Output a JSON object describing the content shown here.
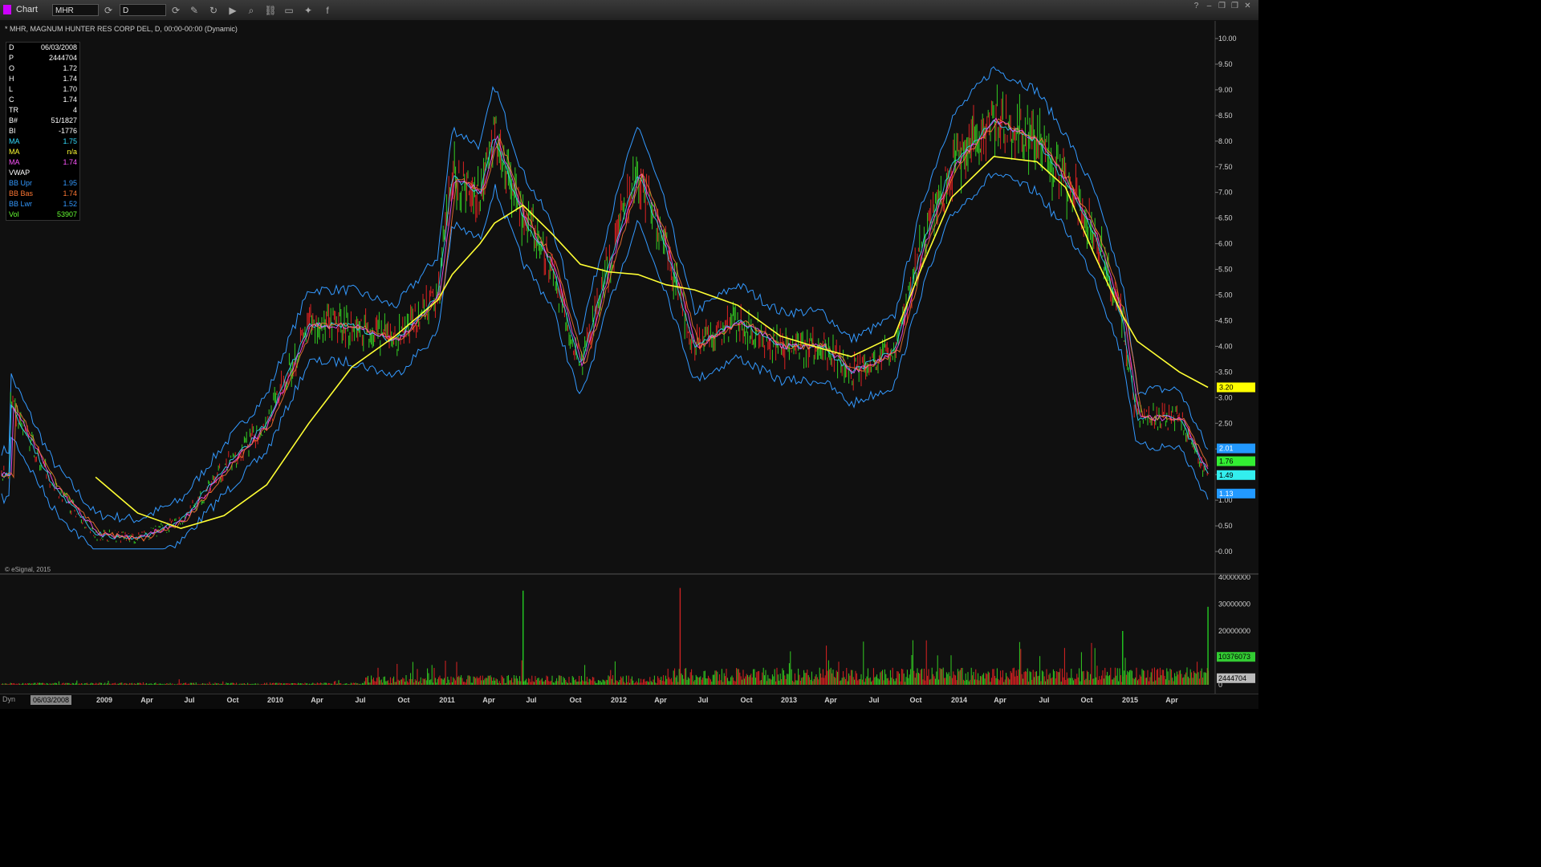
{
  "toolbar": {
    "title": "Chart",
    "symbol": "MHR",
    "interval": "D",
    "icons": [
      "refresh-icon",
      "interval-icon",
      "pencil-icon",
      "cycle-icon",
      "play-icon",
      "search-icon",
      "link-icon",
      "comment-icon",
      "twitter-icon",
      "facebook-icon"
    ],
    "window_icons": [
      "help-icon",
      "minimize-icon",
      "restore-icon",
      "close-icon"
    ]
  },
  "header": {
    "text": "* MHR, MAGNUM HUNTER RES CORP DEL, D, 00:00-00:00 (Dynamic)"
  },
  "data_box": [
    {
      "label": "D",
      "value": "06/03/2008",
      "color": "#ffffff"
    },
    {
      "label": "P",
      "value": "2444704",
      "color": "#ffffff"
    },
    {
      "label": "O",
      "value": "1.72",
      "color": "#ffffff"
    },
    {
      "label": "H",
      "value": "1.74",
      "color": "#ffffff"
    },
    {
      "label": "L",
      "value": "1.70",
      "color": "#ffffff"
    },
    {
      "label": "C",
      "value": "1.74",
      "color": "#ffffff"
    },
    {
      "label": "TR",
      "value": "4",
      "color": "#ffffff"
    },
    {
      "label": "B#",
      "value": "51/1827",
      "color": "#ffffff"
    },
    {
      "label": "BI",
      "value": "-1776",
      "color": "#ffffff"
    },
    {
      "label": "MA",
      "value": "1.75",
      "color": "#33ddff"
    },
    {
      "label": "MA",
      "value": "n/a",
      "color": "#ffff33"
    },
    {
      "label": "MA",
      "value": "1.74",
      "color": "#ff55ff"
    },
    {
      "label": "VWAP",
      "value": "",
      "color": "#ffffff"
    },
    {
      "label": "BB Upr",
      "value": "1.95",
      "color": "#3399ff"
    },
    {
      "label": "BB Bas",
      "value": "1.74",
      "color": "#ff7733"
    },
    {
      "label": "BB Lwr",
      "value": "1.52",
      "color": "#3399ff"
    },
    {
      "label": "Vol",
      "value": "53907",
      "color": "#66ff33"
    }
  ],
  "footer": {
    "dyn_label": "Dyn",
    "date": "06/03/2008",
    "esignal": "© eSignal, 2015"
  },
  "chart_data": [
    {
      "type": "line",
      "title": "MHR, MAGNUM HUNTER RES CORP DEL, D",
      "ylim": [
        0,
        10
      ],
      "yticks": [
        "0.00",
        "0.50",
        "1.00",
        "1.50",
        "2.00",
        "2.50",
        "3.00",
        "3.50",
        "4.00",
        "4.50",
        "5.00",
        "5.50",
        "6.00",
        "6.50",
        "7.00",
        "7.50",
        "8.00",
        "8.50",
        "9.00",
        "9.50",
        "10.00"
      ],
      "xtick_labels": [
        "2009",
        "Apr",
        "Jul",
        "Oct",
        "2010",
        "Apr",
        "Jul",
        "Oct",
        "2011",
        "Apr",
        "Jul",
        "Oct",
        "2012",
        "Apr",
        "Jul",
        "Oct",
        "2013",
        "Apr",
        "Jul",
        "Oct",
        "2014",
        "Apr",
        "Jul",
        "Oct",
        "2015",
        "Apr"
      ],
      "x_dates": [
        "2008-06",
        "2008-09",
        "2008-12",
        "2009-03",
        "2009-06",
        "2009-09",
        "2009-12",
        "2010-03",
        "2010-06",
        "2010-09",
        "2010-12",
        "2011-01",
        "2011-03",
        "2011-04",
        "2011-06",
        "2011-08",
        "2011-10",
        "2011-12",
        "2012-02",
        "2012-04",
        "2012-06",
        "2012-09",
        "2012-12",
        "2013-03",
        "2013-05",
        "2013-08",
        "2013-10",
        "2013-12",
        "2014-03",
        "2014-06",
        "2014-08",
        "2014-10",
        "2014-12",
        "2015-01",
        "2015-04",
        "2015-06"
      ],
      "series": [
        {
          "name": "Price",
          "color": "#55cc33",
          "values": [
            2.9,
            1.3,
            0.35,
            0.25,
            0.6,
            1.6,
            2.5,
            4.4,
            4.4,
            4.1,
            5.0,
            7.3,
            7.0,
            8.1,
            6.5,
            5.6,
            3.6,
            5.6,
            7.4,
            5.9,
            4.0,
            4.5,
            4.0,
            4.0,
            3.5,
            3.9,
            6.0,
            7.5,
            8.4,
            8.0,
            7.2,
            6.2,
            4.5,
            2.6,
            2.6,
            1.5
          ]
        },
        {
          "name": "MA",
          "color": "#ffff33",
          "values": [
            null,
            null,
            1.45,
            0.75,
            0.45,
            0.7,
            1.3,
            2.5,
            3.6,
            4.2,
            4.9,
            5.4,
            6.0,
            6.4,
            6.75,
            6.2,
            5.6,
            5.45,
            5.4,
            5.2,
            5.1,
            4.8,
            4.2,
            3.95,
            3.8,
            4.2,
            5.6,
            6.9,
            7.7,
            7.6,
            7.1,
            5.8,
            4.6,
            4.1,
            3.5,
            3.2
          ]
        }
      ],
      "right_labels": [
        {
          "value": "3.20",
          "y": 3.2,
          "bg": "#ffff00",
          "fg": "#000"
        },
        {
          "value": "2.01",
          "y": 2.01,
          "bg": "#2299ff",
          "fg": "#fff"
        },
        {
          "value": "1.76",
          "y": 1.76,
          "bg": "#33ee33",
          "fg": "#000"
        },
        {
          "value": "1.49",
          "y": 1.49,
          "bg": "#33eeee",
          "fg": "#000"
        },
        {
          "value": "1.13",
          "y": 1.13,
          "bg": "#2299ff",
          "fg": "#fff"
        }
      ]
    },
    {
      "type": "bar",
      "title": "Volume",
      "ylim": [
        0,
        40000000
      ],
      "yticks": [
        "0",
        "10000000",
        "20000000",
        "30000000",
        "40000000"
      ],
      "spikes": [
        {
          "date": "2011-06",
          "value": 35000000,
          "color": "#22cc22"
        },
        {
          "date": "2012-05",
          "value": 36000000,
          "color": "#cc2222"
        },
        {
          "date": "2014-12",
          "value": 20000000,
          "color": "#22cc22"
        },
        {
          "date": "2015-06",
          "value": 29000000,
          "color": "#22cc22"
        }
      ],
      "right_labels": [
        {
          "value": "10376073",
          "bg": "#33cc33",
          "fg": "#000"
        },
        {
          "value": "2444704",
          "bg": "#bbbbbb",
          "fg": "#000"
        }
      ]
    }
  ]
}
